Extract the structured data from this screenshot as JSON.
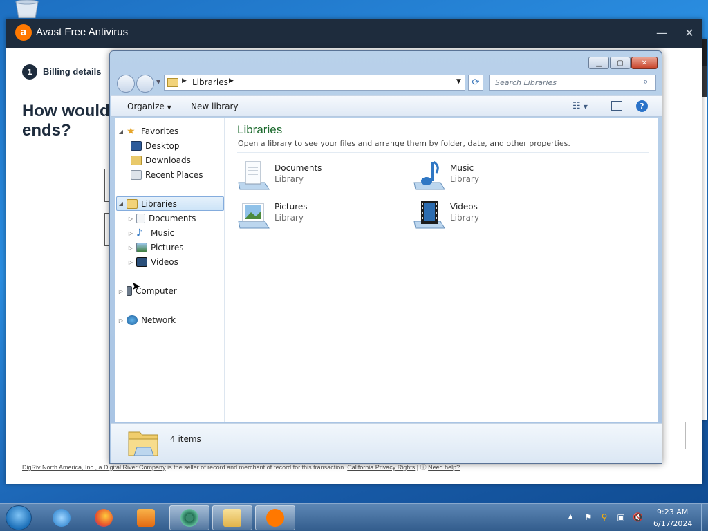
{
  "avast": {
    "title": "Avast Free Antivirus",
    "step_number": "1",
    "step_label": "Billing details",
    "heading": "How would ends?",
    "footer_seller": "DigRiv North America, Inc., a Digital River Company",
    "footer_text": " is the seller of record and merchant of record for this transaction.",
    "footer_privacy": "California Privacy Rights",
    "footer_sep": " | ",
    "footer_help": "Need help?"
  },
  "explorer": {
    "address": "Libraries",
    "search_placeholder": "Search Libraries",
    "toolbar": {
      "organize": "Organize",
      "new_library": "New library"
    },
    "nav": {
      "favorites": "Favorites",
      "desktop": "Desktop",
      "downloads": "Downloads",
      "recent_places": "Recent Places",
      "libraries": "Libraries",
      "documents": "Documents",
      "music": "Music",
      "pictures": "Pictures",
      "videos": "Videos",
      "computer": "Computer",
      "network": "Network"
    },
    "content": {
      "title": "Libraries",
      "subtitle": "Open a library to see your files and arrange them by folder, date, and other properties.",
      "items": [
        {
          "name": "Documents",
          "type": "Library"
        },
        {
          "name": "Music",
          "type": "Library"
        },
        {
          "name": "Pictures",
          "type": "Library"
        },
        {
          "name": "Videos",
          "type": "Library"
        }
      ]
    },
    "details": {
      "count": "4 items"
    }
  },
  "taskbar": {
    "time": "9:23 AM",
    "date": "6/17/2024"
  },
  "colors": {
    "avast_orange": "#ff7800",
    "avast_navy": "#1e2c3d",
    "libraries_title_green": "#1e6b2f",
    "explorer_frame": "#b9d1ea"
  }
}
